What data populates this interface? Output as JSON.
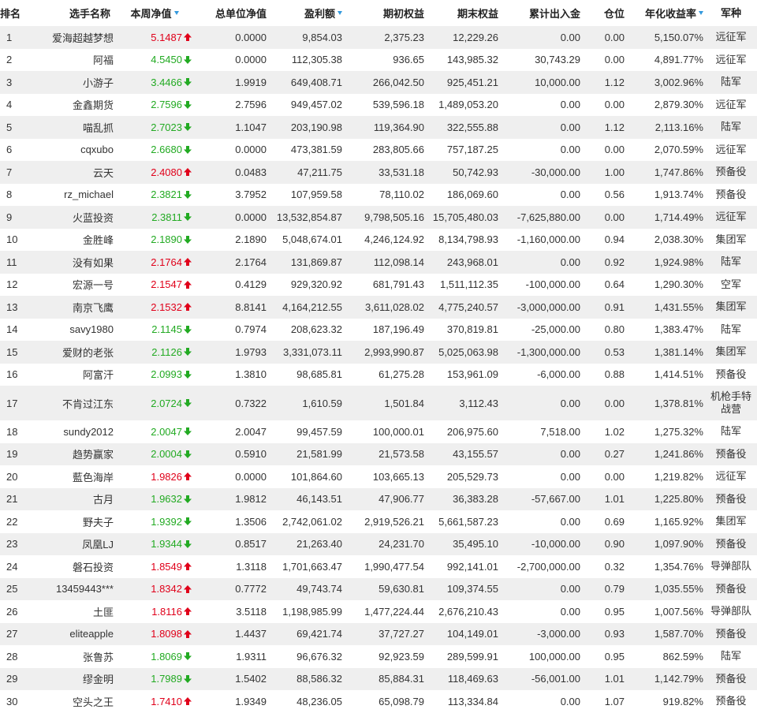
{
  "colors": {
    "up": "#e0001a",
    "down": "#22aa22",
    "sort_icon": "#3399dd",
    "row_alt": "#efefef"
  },
  "headers": {
    "rank": "排名",
    "name": "选手名称",
    "weekly": "本周净值",
    "total_nav": "总单位净值",
    "profit": "盈利额",
    "start_equity": "期初权益",
    "end_equity": "期末权益",
    "cum_flow": "累计出入金",
    "position": "仓位",
    "annual": "年化收益率",
    "army": "军种"
  },
  "rows": [
    {
      "rank": "1",
      "name": "爱海超越梦想",
      "weekly": "5.1487",
      "dir": "up",
      "total": "0.0000",
      "profit": "9,854.03",
      "start": "2,375.23",
      "end": "12,229.26",
      "flow": "0.00",
      "pos": "0.00",
      "annual": "5,150.07%",
      "army": "远征军"
    },
    {
      "rank": "2",
      "name": "阿福",
      "weekly": "4.5450",
      "dir": "down",
      "total": "0.0000",
      "profit": "112,305.38",
      "start": "936.65",
      "end": "143,985.32",
      "flow": "30,743.29",
      "pos": "0.00",
      "annual": "4,891.77%",
      "army": "远征军"
    },
    {
      "rank": "3",
      "name": "小游子",
      "weekly": "3.4466",
      "dir": "down",
      "total": "1.9919",
      "profit": "649,408.71",
      "start": "266,042.50",
      "end": "925,451.21",
      "flow": "10,000.00",
      "pos": "1.12",
      "annual": "3,002.96%",
      "army": "陆军"
    },
    {
      "rank": "4",
      "name": "金鑫期货",
      "weekly": "2.7596",
      "dir": "down",
      "total": "2.7596",
      "profit": "949,457.02",
      "start": "539,596.18",
      "end": "1,489,053.20",
      "flow": "0.00",
      "pos": "0.00",
      "annual": "2,879.30%",
      "army": "远征军"
    },
    {
      "rank": "5",
      "name": "喵乱抓",
      "weekly": "2.7023",
      "dir": "down",
      "total": "1.1047",
      "profit": "203,190.98",
      "start": "119,364.90",
      "end": "322,555.88",
      "flow": "0.00",
      "pos": "1.12",
      "annual": "2,113.16%",
      "army": "陆军"
    },
    {
      "rank": "6",
      "name": "cqxubo",
      "weekly": "2.6680",
      "dir": "down",
      "total": "0.0000",
      "profit": "473,381.59",
      "start": "283,805.66",
      "end": "757,187.25",
      "flow": "0.00",
      "pos": "0.00",
      "annual": "2,070.59%",
      "army": "远征军"
    },
    {
      "rank": "7",
      "name": "云天",
      "weekly": "2.4080",
      "dir": "up",
      "total": "0.0483",
      "profit": "47,211.75",
      "start": "33,531.18",
      "end": "50,742.93",
      "flow": "-30,000.00",
      "pos": "1.00",
      "annual": "1,747.86%",
      "army": "预备役"
    },
    {
      "rank": "8",
      "name": "rz_michael",
      "weekly": "2.3821",
      "dir": "down",
      "total": "3.7952",
      "profit": "107,959.58",
      "start": "78,110.02",
      "end": "186,069.60",
      "flow": "0.00",
      "pos": "0.56",
      "annual": "1,913.74%",
      "army": "预备役"
    },
    {
      "rank": "9",
      "name": "火蓝投资",
      "weekly": "2.3811",
      "dir": "down",
      "total": "0.0000",
      "profit": "13,532,854.87",
      "start": "9,798,505.16",
      "end": "15,705,480.03",
      "flow": "-7,625,880.00",
      "pos": "0.00",
      "annual": "1,714.49%",
      "army": "远征军"
    },
    {
      "rank": "10",
      "name": "金胜峰",
      "weekly": "2.1890",
      "dir": "down",
      "total": "2.1890",
      "profit": "5,048,674.01",
      "start": "4,246,124.92",
      "end": "8,134,798.93",
      "flow": "-1,160,000.00",
      "pos": "0.94",
      "annual": "2,038.30%",
      "army": "集团军"
    },
    {
      "rank": "11",
      "name": "没有如果",
      "weekly": "2.1764",
      "dir": "up",
      "total": "2.1764",
      "profit": "131,869.87",
      "start": "112,098.14",
      "end": "243,968.01",
      "flow": "0.00",
      "pos": "0.92",
      "annual": "1,924.98%",
      "army": "陆军"
    },
    {
      "rank": "12",
      "name": "宏源一号",
      "weekly": "2.1547",
      "dir": "up",
      "total": "0.4129",
      "profit": "929,320.92",
      "start": "681,791.43",
      "end": "1,511,112.35",
      "flow": "-100,000.00",
      "pos": "0.64",
      "annual": "1,290.30%",
      "army": "空军"
    },
    {
      "rank": "13",
      "name": "南京飞鹰",
      "weekly": "2.1532",
      "dir": "up",
      "total": "8.8141",
      "profit": "4,164,212.55",
      "start": "3,611,028.02",
      "end": "4,775,240.57",
      "flow": "-3,000,000.00",
      "pos": "0.91",
      "annual": "1,431.55%",
      "army": "集团军"
    },
    {
      "rank": "14",
      "name": "savy1980",
      "weekly": "2.1145",
      "dir": "down",
      "total": "0.7974",
      "profit": "208,623.32",
      "start": "187,196.49",
      "end": "370,819.81",
      "flow": "-25,000.00",
      "pos": "0.80",
      "annual": "1,383.47%",
      "army": "陆军"
    },
    {
      "rank": "15",
      "name": "爱财的老张",
      "weekly": "2.1126",
      "dir": "down",
      "total": "1.9793",
      "profit": "3,331,073.11",
      "start": "2,993,990.87",
      "end": "5,025,063.98",
      "flow": "-1,300,000.00",
      "pos": "0.53",
      "annual": "1,381.14%",
      "army": "集团军"
    },
    {
      "rank": "16",
      "name": "阿富汗",
      "weekly": "2.0993",
      "dir": "down",
      "total": "1.3810",
      "profit": "98,685.81",
      "start": "61,275.28",
      "end": "153,961.09",
      "flow": "-6,000.00",
      "pos": "0.88",
      "annual": "1,414.51%",
      "army": "预备役"
    },
    {
      "rank": "17",
      "name": "不肯过江东",
      "weekly": "2.0724",
      "dir": "down",
      "total": "0.7322",
      "profit": "1,610.59",
      "start": "1,501.84",
      "end": "3,112.43",
      "flow": "0.00",
      "pos": "0.00",
      "annual": "1,378.81%",
      "army": "机枪手特战营"
    },
    {
      "rank": "18",
      "name": "sundy2012",
      "weekly": "2.0047",
      "dir": "down",
      "total": "2.0047",
      "profit": "99,457.59",
      "start": "100,000.01",
      "end": "206,975.60",
      "flow": "7,518.00",
      "pos": "1.02",
      "annual": "1,275.32%",
      "army": "陆军"
    },
    {
      "rank": "19",
      "name": "趋势赢家",
      "weekly": "2.0004",
      "dir": "down",
      "total": "0.5910",
      "profit": "21,581.99",
      "start": "21,573.58",
      "end": "43,155.57",
      "flow": "0.00",
      "pos": "0.27",
      "annual": "1,241.86%",
      "army": "预备役"
    },
    {
      "rank": "20",
      "name": "藍色海岸",
      "weekly": "1.9826",
      "dir": "up",
      "total": "0.0000",
      "profit": "101,864.60",
      "start": "103,665.13",
      "end": "205,529.73",
      "flow": "0.00",
      "pos": "0.00",
      "annual": "1,219.82%",
      "army": "远征军"
    },
    {
      "rank": "21",
      "name": "古月",
      "weekly": "1.9632",
      "dir": "down",
      "total": "1.9812",
      "profit": "46,143.51",
      "start": "47,906.77",
      "end": "36,383.28",
      "flow": "-57,667.00",
      "pos": "1.01",
      "annual": "1,225.80%",
      "army": "预备役"
    },
    {
      "rank": "22",
      "name": "野夫子",
      "weekly": "1.9392",
      "dir": "down",
      "total": "1.3506",
      "profit": "2,742,061.02",
      "start": "2,919,526.21",
      "end": "5,661,587.23",
      "flow": "0.00",
      "pos": "0.69",
      "annual": "1,165.92%",
      "army": "集团军"
    },
    {
      "rank": "23",
      "name": "凤凰LJ",
      "weekly": "1.9344",
      "dir": "down",
      "total": "0.8517",
      "profit": "21,263.40",
      "start": "24,231.70",
      "end": "35,495.10",
      "flow": "-10,000.00",
      "pos": "0.90",
      "annual": "1,097.90%",
      "army": "预备役"
    },
    {
      "rank": "24",
      "name": "磐石投资",
      "weekly": "1.8549",
      "dir": "up",
      "total": "1.3118",
      "profit": "1,701,663.47",
      "start": "1,990,477.54",
      "end": "992,141.01",
      "flow": "-2,700,000.00",
      "pos": "0.32",
      "annual": "1,354.76%",
      "army": "导弹部队"
    },
    {
      "rank": "25",
      "name": "13459443***",
      "weekly": "1.8342",
      "dir": "up",
      "total": "0.7772",
      "profit": "49,743.74",
      "start": "59,630.81",
      "end": "109,374.55",
      "flow": "0.00",
      "pos": "0.79",
      "annual": "1,035.55%",
      "army": "预备役"
    },
    {
      "rank": "26",
      "name": "土匪",
      "weekly": "1.8116",
      "dir": "up",
      "total": "3.5118",
      "profit": "1,198,985.99",
      "start": "1,477,224.44",
      "end": "2,676,210.43",
      "flow": "0.00",
      "pos": "0.95",
      "annual": "1,007.56%",
      "army": "导弹部队"
    },
    {
      "rank": "27",
      "name": "eliteapple",
      "weekly": "1.8098",
      "dir": "up",
      "total": "1.4437",
      "profit": "69,421.74",
      "start": "37,727.27",
      "end": "104,149.01",
      "flow": "-3,000.00",
      "pos": "0.93",
      "annual": "1,587.70%",
      "army": "预备役"
    },
    {
      "rank": "28",
      "name": "张鲁苏",
      "weekly": "1.8069",
      "dir": "down",
      "total": "1.9311",
      "profit": "96,676.32",
      "start": "92,923.59",
      "end": "289,599.91",
      "flow": "100,000.00",
      "pos": "0.95",
      "annual": "862.59%",
      "army": "陆军"
    },
    {
      "rank": "29",
      "name": "缪金明",
      "weekly": "1.7989",
      "dir": "down",
      "total": "1.5402",
      "profit": "88,586.32",
      "start": "85,884.31",
      "end": "118,469.63",
      "flow": "-56,001.00",
      "pos": "1.01",
      "annual": "1,142.79%",
      "army": "预备役"
    },
    {
      "rank": "30",
      "name": "空头之王",
      "weekly": "1.7410",
      "dir": "up",
      "total": "1.9349",
      "profit": "48,236.05",
      "start": "65,098.79",
      "end": "113,334.84",
      "flow": "0.00",
      "pos": "1.07",
      "annual": "919.82%",
      "army": "预备役"
    }
  ]
}
